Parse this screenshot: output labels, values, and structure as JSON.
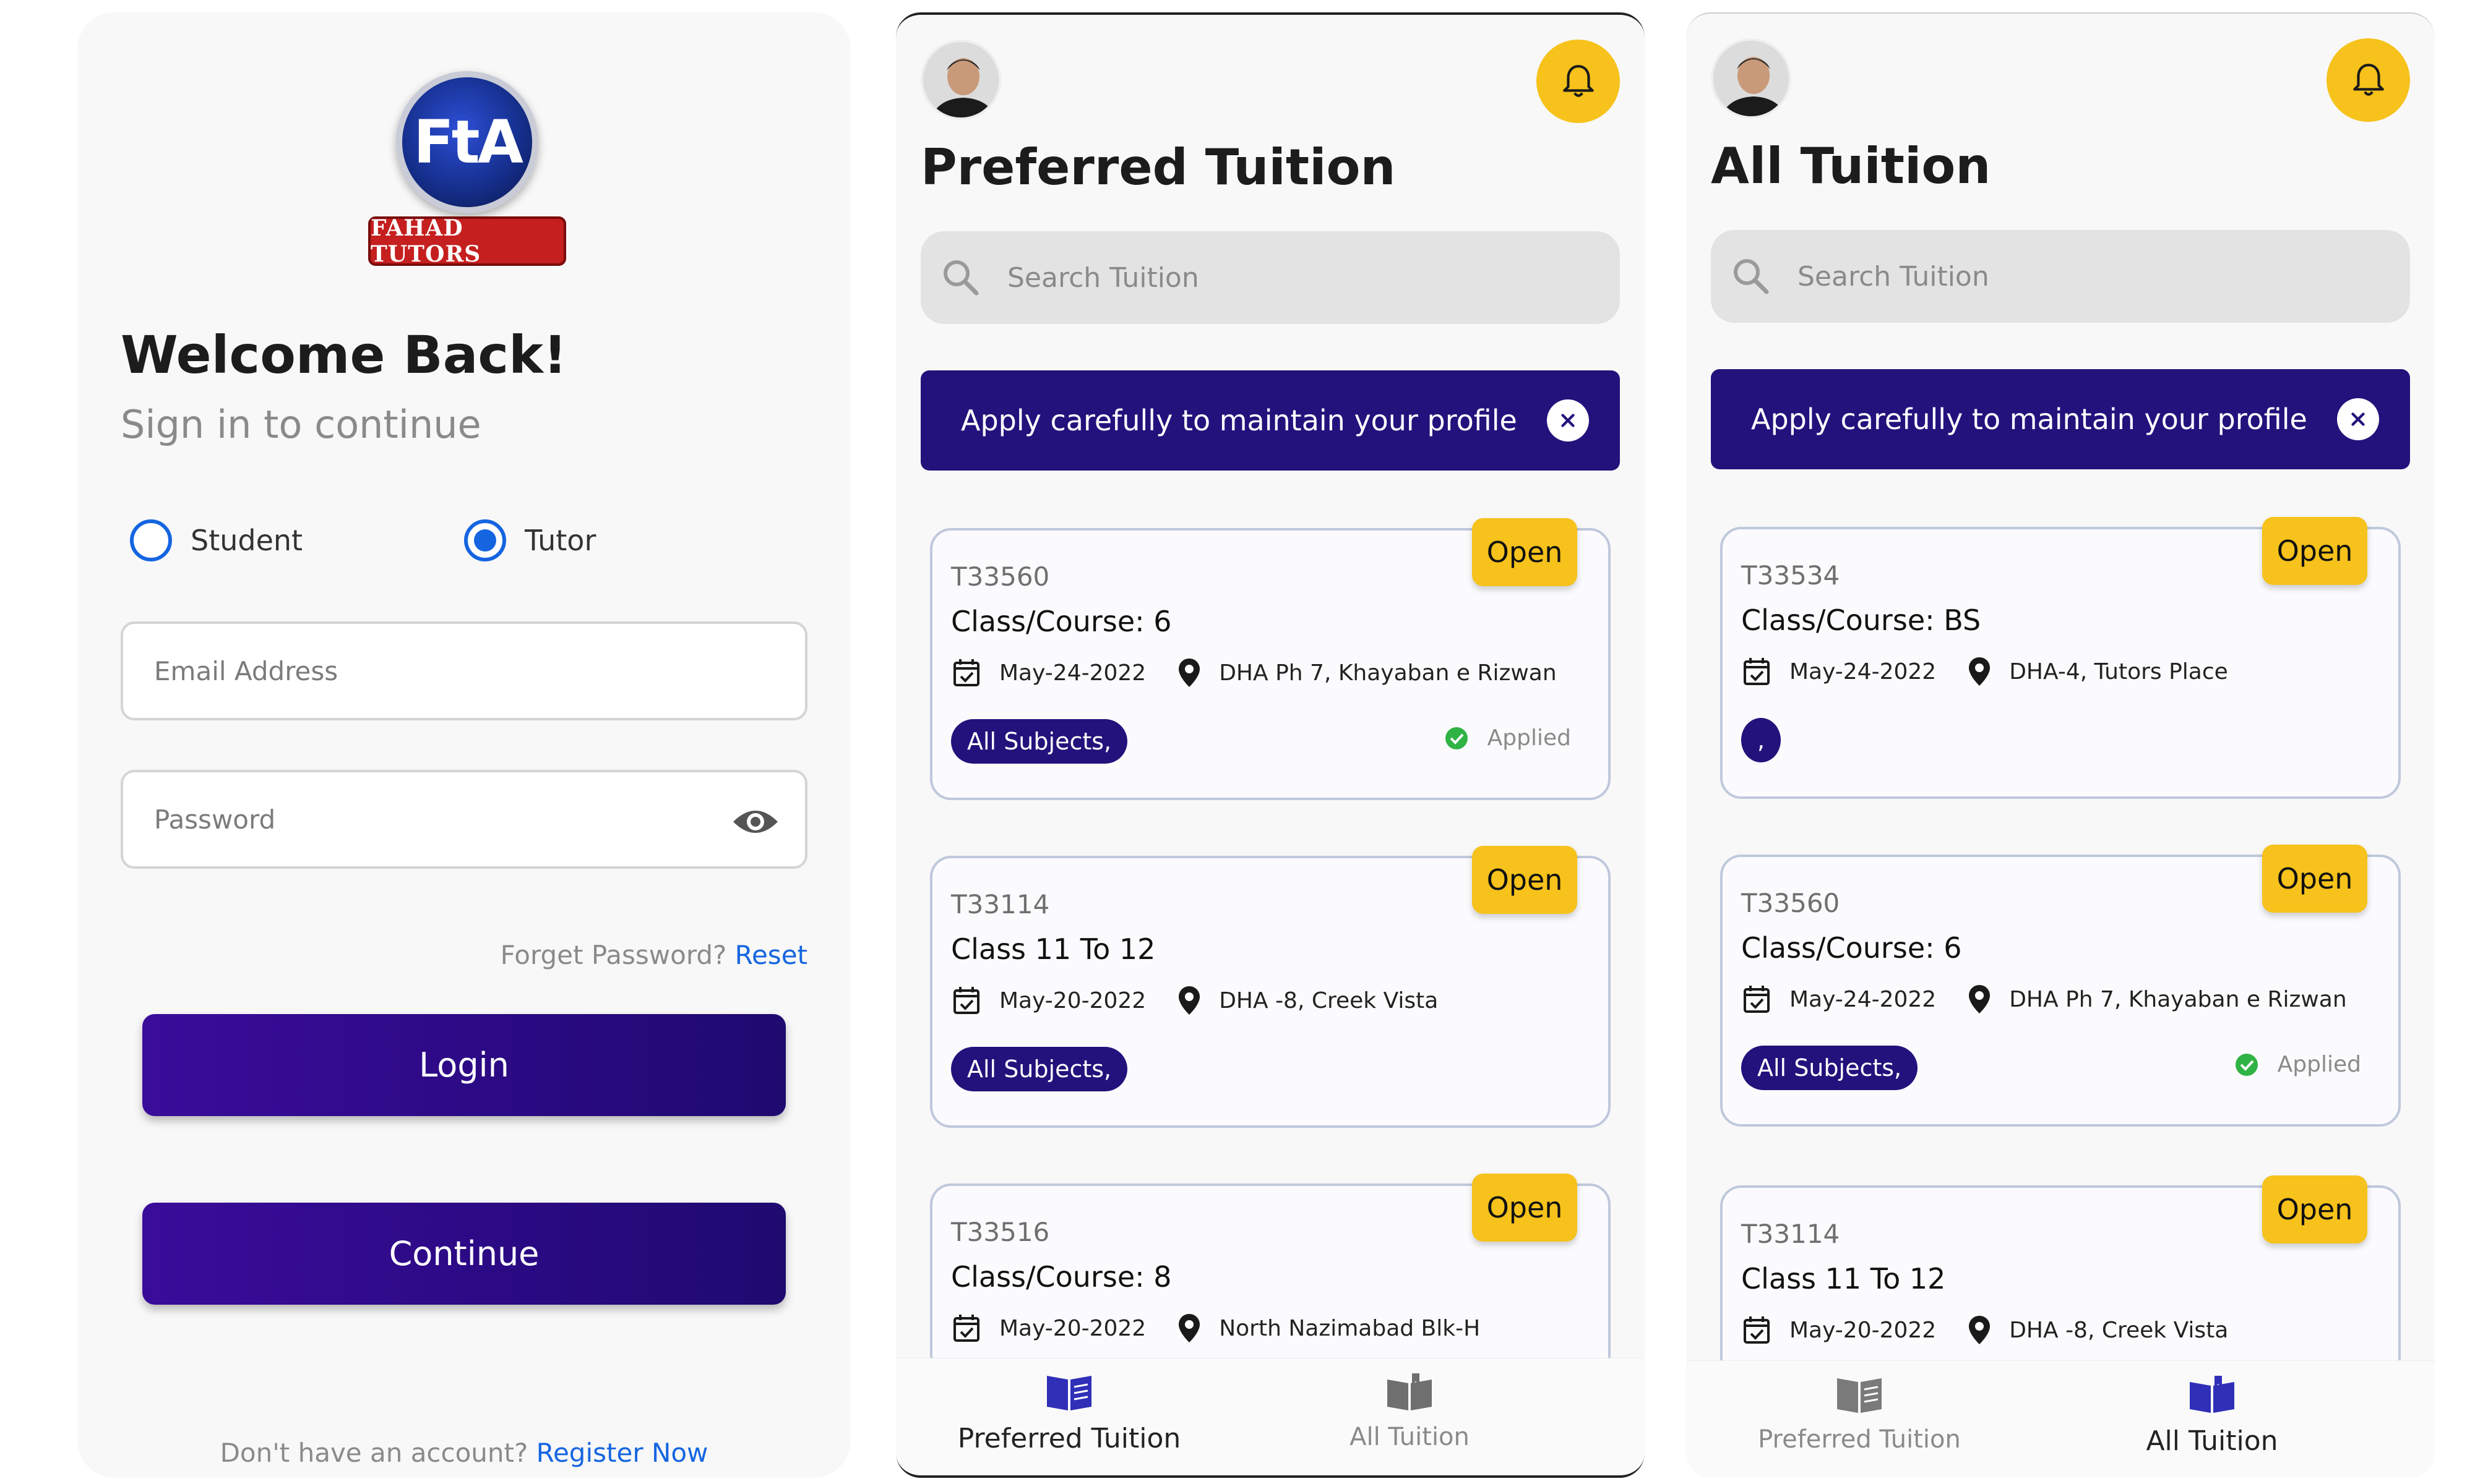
{
  "login": {
    "logo_mark": "FtA",
    "logo_banner": "FAHAD TUTORS",
    "title": "Welcome Back!",
    "subtitle": "Sign in to continue",
    "role_options": [
      {
        "label": "Student",
        "selected": false
      },
      {
        "label": "Tutor",
        "selected": true
      }
    ],
    "email_placeholder": "Email Address",
    "password_placeholder": "Password",
    "forgot_text": "Forget Password?",
    "reset_link": "Reset",
    "login_label": "Login",
    "continue_label": "Continue",
    "register_text": "Don't have an account?",
    "register_link": "Register Now"
  },
  "preferred": {
    "title": "Preferred Tuition",
    "search_placeholder": "Search Tuition",
    "banner_text": "Apply carefully to maintain your profile",
    "cards": [
      {
        "id": "T33560",
        "class": "Class/Course: 6",
        "date": "May-24-2022",
        "location": "DHA Ph 7, Khayaban e Rizwan",
        "subjects": "All Subjects,",
        "applied": "Applied",
        "status": "Open"
      },
      {
        "id": "T33114",
        "class": "Class 11 To 12",
        "date": "May-20-2022",
        "location": "DHA -8, Creek Vista",
        "subjects": "All Subjects,",
        "applied": "",
        "status": "Open"
      },
      {
        "id": "T33516",
        "class": "Class/Course: 8",
        "date": "May-20-2022",
        "location": "North Nazimabad Blk-H",
        "subjects": "",
        "applied": "",
        "status": "Open"
      }
    ]
  },
  "all": {
    "title": "All Tuition",
    "search_placeholder": "Search Tuition",
    "banner_text": "Apply carefully to maintain your profile",
    "cards": [
      {
        "id": "T33534",
        "class": "Class/Course: BS",
        "date": "May-24-2022",
        "location": "DHA-4, Tutors Place",
        "subjects": ",",
        "applied": "",
        "status": "Open"
      },
      {
        "id": "T33560",
        "class": "Class/Course: 6",
        "date": "May-24-2022",
        "location": "DHA Ph 7, Khayaban e Rizwan",
        "subjects": "All Subjects,",
        "applied": "Applied",
        "status": "Open"
      },
      {
        "id": "T33114",
        "class": "Class 11 To 12",
        "date": "May-20-2022",
        "location": "DHA -8, Creek Vista",
        "subjects": "",
        "applied": "",
        "status": "Open"
      }
    ]
  },
  "nav": {
    "preferred_label": "Preferred Tuition",
    "all_label": "All Tuition"
  },
  "colors": {
    "primary": "#23127c",
    "accent": "#f6c21b",
    "link": "#1565e0",
    "applied_check": "#2fb344"
  },
  "icons": {
    "bell": "bell-icon",
    "search": "search-icon",
    "close": "close-icon",
    "calendar": "calendar-check-icon",
    "location": "map-pin-icon",
    "eye": "eye-icon",
    "check": "check-circle-icon",
    "book": "open-book-icon"
  }
}
